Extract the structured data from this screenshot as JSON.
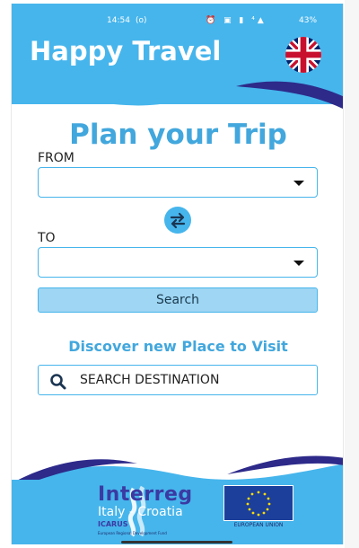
{
  "status_bar": {
    "time": "14:54",
    "indicator": "(o)",
    "icons": "⏰ ▣ ▮ ⁴▲",
    "battery": "43%"
  },
  "header": {
    "title": "Happy Travel",
    "language_icon": "uk-flag-icon"
  },
  "planner": {
    "title": "Plan your Trip",
    "from_label": "FROM",
    "from_value": "",
    "to_label": "TO",
    "to_value": "",
    "swap_icon": "swap-arrows-icon",
    "search_label": "Search"
  },
  "discover": {
    "title": "Discover new Place to Visit",
    "search_placeholder": "SEARCH DESTINATION",
    "search_icon": "search-icon"
  },
  "footer": {
    "interreg_name": "Interreg",
    "interreg_region": "Italy - Croatia",
    "project_name": "ICARUS",
    "fund_text": "European Regional Development Fund",
    "eu_label": "EUROPEAN UNION"
  },
  "colors": {
    "primary": "#46b5ec",
    "accent_dark": "#3b3aa3",
    "title_blue": "#42a7dd"
  }
}
